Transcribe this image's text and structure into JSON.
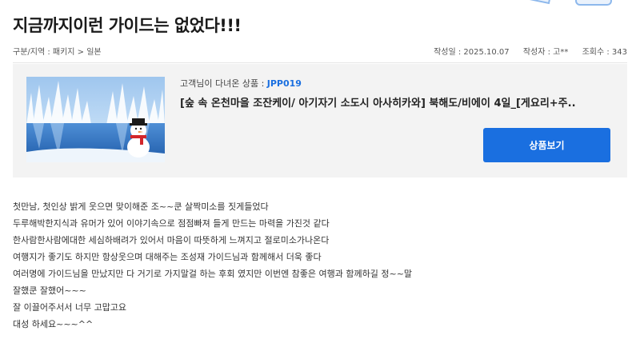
{
  "review": {
    "title": "지금까지이런 가이드는 없었다!!!",
    "breadcrumb": "구분/지역 : 패키지 > 일본",
    "date": "작성일 : 2025.10.07",
    "author": "작성자 : 고**",
    "views": "조회수 : 343",
    "body_lines": [
      "첫만남, 첫인상 밝게 웃으면 맞이해준 조~~쿤   살짝미소를 짓게들었다",
      "두루해박한지식과 유머가 있어 이야기속으로 점점빠져 들게 만드는 마력을 가진것 같다",
      "한사람한사람에대한 세심하배려가 있어서 마음이 따뜻하게 느껴지고 절로미소가나온다",
      "여행지가 좋기도 하지만 항상웃으며 대해주는   조성재 가이드님과 함께해서 더욱 좋다",
      "여러명에 가이드님을 만났지만 다  거기로 가지말걸 하는 후회 였지만 이번엔 참좋은 여행과 함께하길 정~~말",
      "잘했쿤 잘했어~~~",
      "잘 이끌어주서서  너무 고맙고요",
      "대성 하세요~~~^^"
    ]
  },
  "product": {
    "label": "고객님이 다녀온 상품 :",
    "code": "JPP019",
    "name": "[숲 속 온천마을 조잔케이/ 아기자기 소도시 아사히카와] 북해도/비에이 4일_[게요리+주..",
    "button_label": "상품보기",
    "thumbnail_icon": "snowman-winter-lake-image"
  },
  "colors": {
    "accent": "#1a6fe0",
    "card_bg": "#f3f3f3"
  }
}
